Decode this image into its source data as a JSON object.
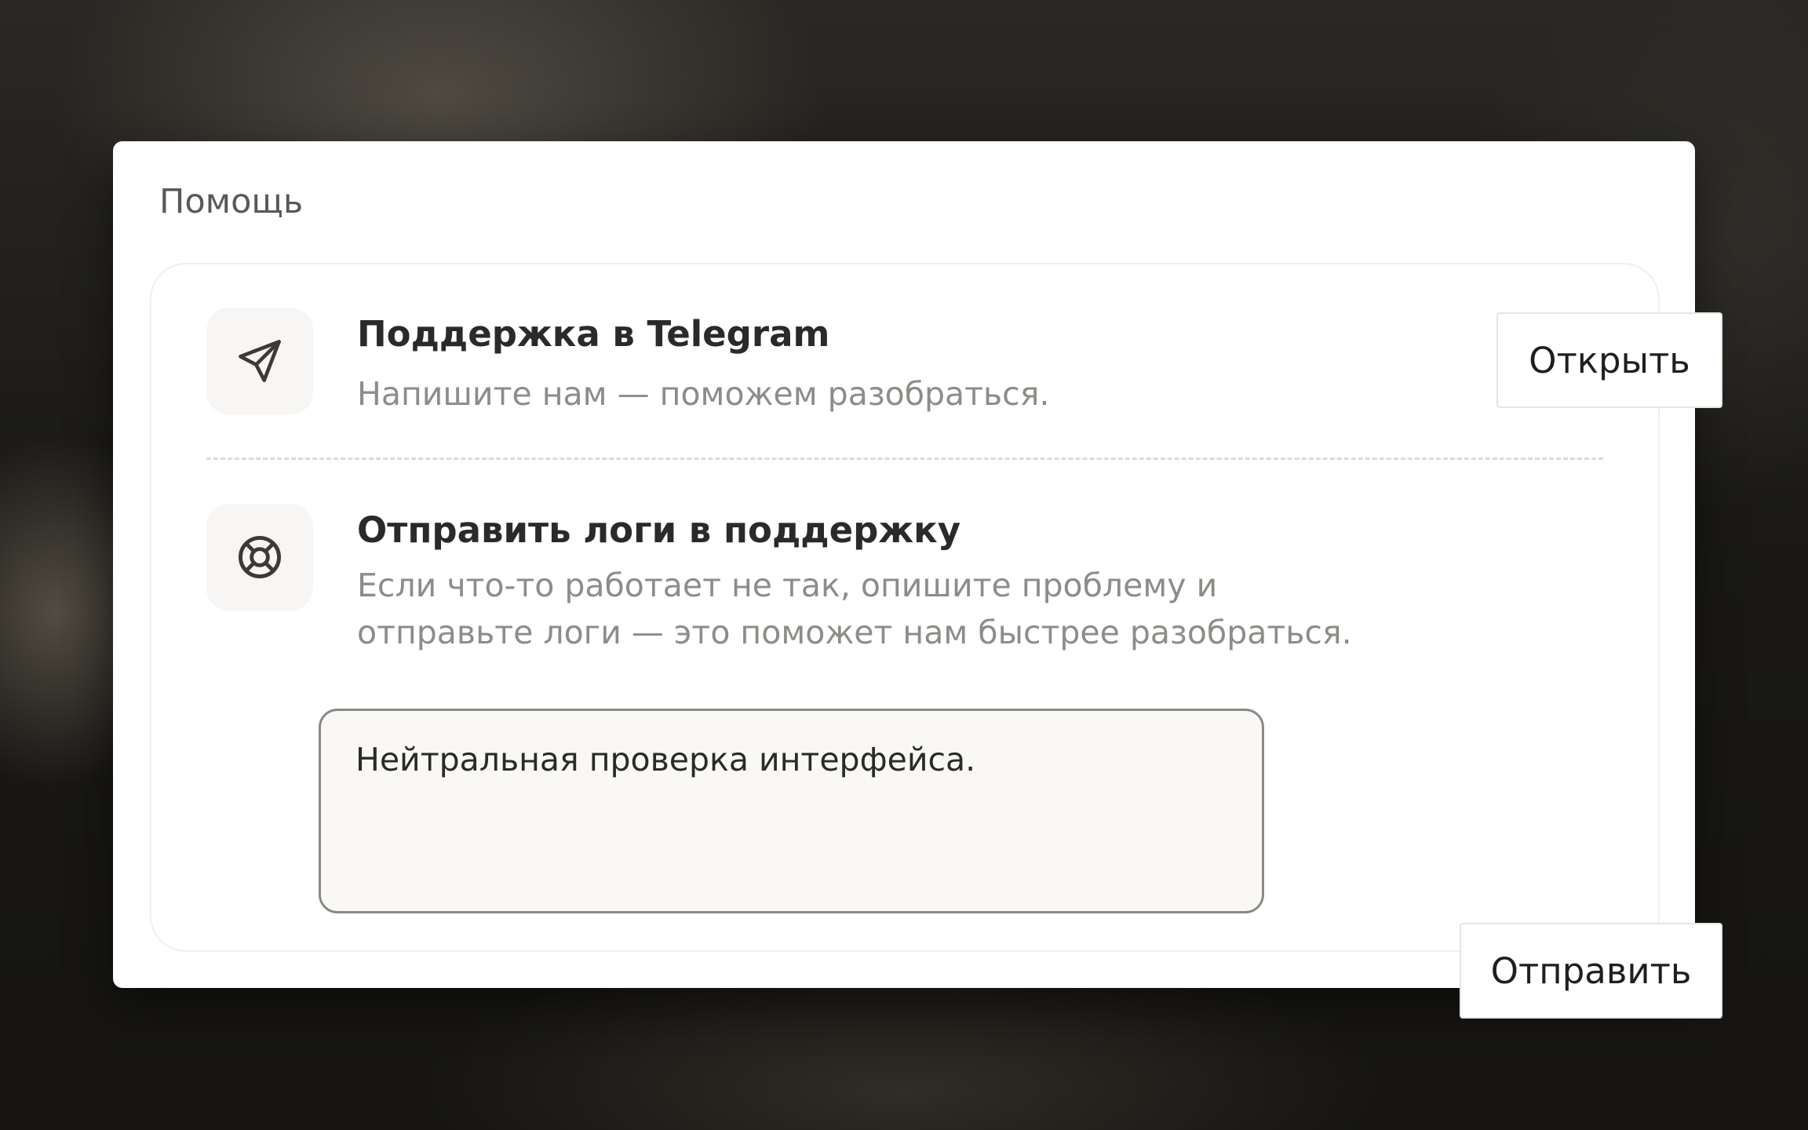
{
  "help": {
    "title": "Помощь",
    "telegram": {
      "icon": "send-icon",
      "title": "Поддержка в Telegram",
      "description": "Напишите нам — поможем разобраться.",
      "button": "Открыть"
    },
    "logs": {
      "icon": "lifebuoy-icon",
      "title": "Отправить логи в поддержку",
      "description_line1": "Если что-то работает не так, опишите проблему и",
      "description_line2": "отправьте логи — это поможет нам быстрее разобраться.",
      "input_value": "Нейтральная проверка интерфейса.",
      "button": "Отправить"
    }
  },
  "colors": {
    "icon_stroke": "#3b3a37",
    "text_primary": "#2a2a28",
    "text_secondary": "#8d8c88"
  }
}
